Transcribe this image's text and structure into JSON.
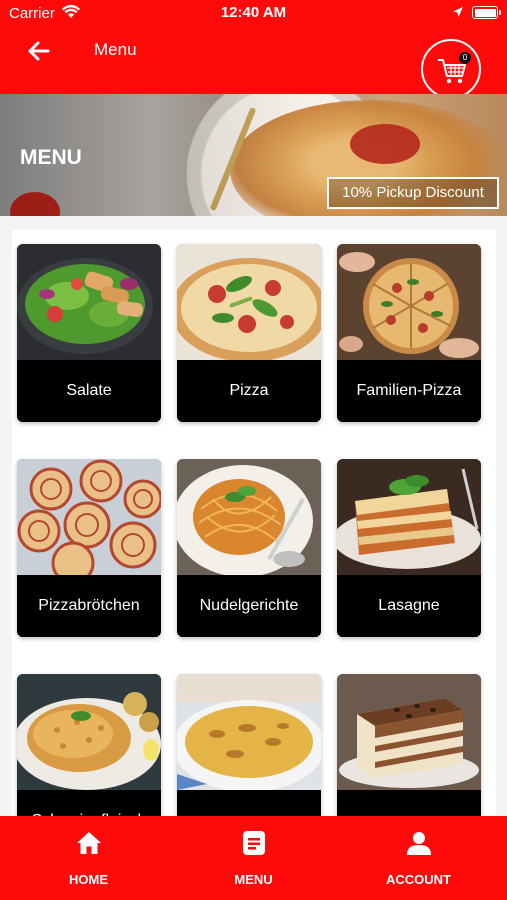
{
  "status_bar": {
    "carrier": "Carrier",
    "time": "12:40 AM"
  },
  "header": {
    "title": "Menu",
    "cart_count": "0"
  },
  "banner": {
    "title": "MENU",
    "discount_label": "10% Pickup Discount"
  },
  "categories": [
    {
      "label": "Salate",
      "image": "salad-photo"
    },
    {
      "label": "Pizza",
      "image": "pizza-photo"
    },
    {
      "label": "Familien-Pizza",
      "image": "family-pizza-photo"
    },
    {
      "label": "Pizzabrötchen",
      "image": "pizza-rolls-photo"
    },
    {
      "label": "Nudelgerichte",
      "image": "spaghetti-photo"
    },
    {
      "label": "Lasagne",
      "image": "lasagne-photo"
    },
    {
      "label": "Schweinefleisch",
      "image": "schnitzel-photo"
    },
    {
      "label": "",
      "image": "gratin-photo"
    },
    {
      "label": "",
      "image": "tiramisu-photo"
    }
  ],
  "bottom_nav": [
    {
      "label": "HOME",
      "icon": "home-icon"
    },
    {
      "label": "MENU",
      "icon": "menu-list-icon"
    },
    {
      "label": "ACCOUNT",
      "icon": "account-icon"
    }
  ],
  "colors": {
    "primary": "#ff0a0a",
    "tile_label_bg": "#000000",
    "text_on_primary": "#ffffff"
  }
}
